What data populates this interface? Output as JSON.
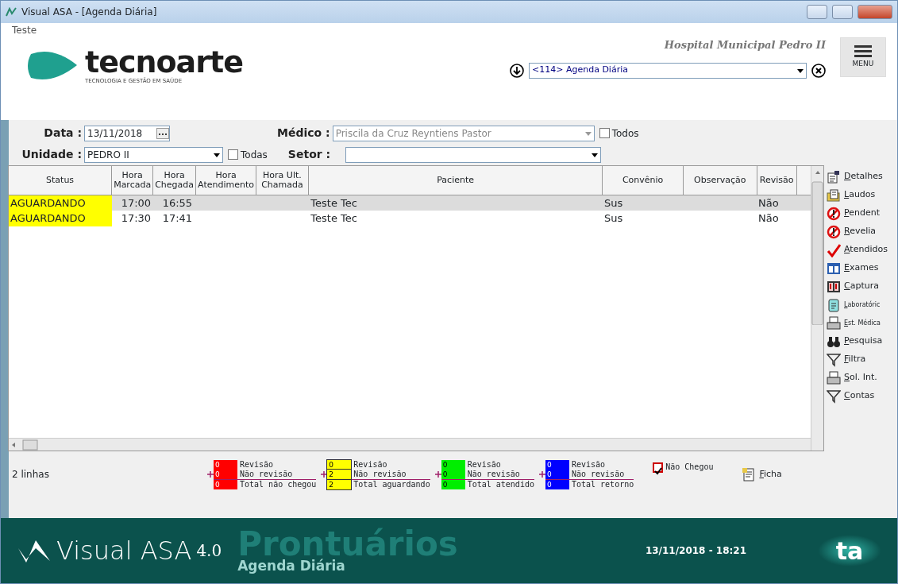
{
  "window": {
    "title": "Visual ASA - [Agenda Diária]"
  },
  "header": {
    "user": "Teste",
    "logo_word": "tecnoarte",
    "logo_tagline": "TECNOLOGIA E GESTÃO EM SAÚDE",
    "hospital": "Hospital Municipal Pedro II",
    "module_select": "<114> Agenda Diária",
    "menu_label": "MENU"
  },
  "filters": {
    "data_label": "Data :",
    "data_value": "13/11/2018",
    "medico_label": "Médico :",
    "medico_value": "Priscila da Cruz Reyntiens Pastor",
    "medico_disabled": true,
    "todos": {
      "label": "Todos",
      "checked": false
    },
    "unidade_label": "Unidade :",
    "unidade_value": "PEDRO II",
    "todas": {
      "label": "Todas",
      "checked": false
    },
    "setor_label": "Setor :"
  },
  "table": {
    "columns": [
      "Status",
      "Hora Marcada",
      "Hora Chegada",
      "Hora Atendimento",
      "Hora Ult. Chamada",
      "Paciente",
      "Convênio",
      "Observação",
      "Revisão"
    ],
    "rows": [
      {
        "selected": true,
        "cells": [
          "AGUARDANDO",
          "17:00",
          "16:55",
          "",
          "",
          "Teste Tec",
          "Sus",
          "",
          "Não"
        ]
      },
      {
        "selected": false,
        "cells": [
          "AGUARDANDO",
          "17:30",
          "17:41",
          "",
          "",
          "Teste Tec",
          "Sus",
          "",
          "Não"
        ]
      }
    ]
  },
  "side_actions": [
    {
      "kind": "details",
      "label": "Detalhes"
    },
    {
      "kind": "report",
      "label": "Laudos"
    },
    {
      "kind": "forbidden",
      "label": "Pendent"
    },
    {
      "kind": "forbidden",
      "label": "Revelia"
    },
    {
      "kind": "check",
      "label": "Atendidos"
    },
    {
      "kind": "exam",
      "label": "Exames"
    },
    {
      "kind": "film",
      "label": "Captura"
    },
    {
      "kind": "lab",
      "label": "Laboratóric",
      "small": true
    },
    {
      "kind": "printer",
      "label": "Est. Médica",
      "small": true
    },
    {
      "kind": "binoculars",
      "label": "Pesquisa"
    },
    {
      "kind": "filter",
      "label": "Filtra"
    },
    {
      "kind": "printer",
      "label": "Sol. Int."
    },
    {
      "kind": "filter",
      "label": "Contas"
    }
  ],
  "status_bar": {
    "row_count": "2 linhas",
    "counters": [
      {
        "color": "#ff0000",
        "items": [
          {
            "value": "0",
            "label": "Revisão"
          },
          {
            "value": "0",
            "label": "Não revisão"
          },
          {
            "value": "0",
            "label": "Total não chegou"
          }
        ]
      },
      {
        "color": "#ffff00",
        "items": [
          {
            "value": "0",
            "label": "Revisão"
          },
          {
            "value": "2",
            "label": "Não revisão"
          },
          {
            "value": "2",
            "label": "Total aguardando"
          }
        ]
      },
      {
        "color": "#00ee00",
        "items": [
          {
            "value": "0",
            "label": "Revisão"
          },
          {
            "value": "0",
            "label": "Não revisão"
          },
          {
            "value": "0",
            "label": "Total atendido"
          }
        ]
      },
      {
        "color": "#0000ff",
        "items": [
          {
            "value": "0",
            "label": "Revisão"
          },
          {
            "value": "0",
            "label": "Não revisão"
          },
          {
            "value": "0",
            "label": "Total retorno"
          }
        ]
      }
    ],
    "nao_chegou": {
      "label": "Não Chegou",
      "checked": true
    },
    "ficha": "Ficha"
  },
  "banner": {
    "product": "Visual ASA",
    "version": "4.0",
    "module": "Prontuários",
    "screen": "Agenda Diária",
    "datetime": "13/11/2018 - 18:21",
    "logo": "ta"
  }
}
